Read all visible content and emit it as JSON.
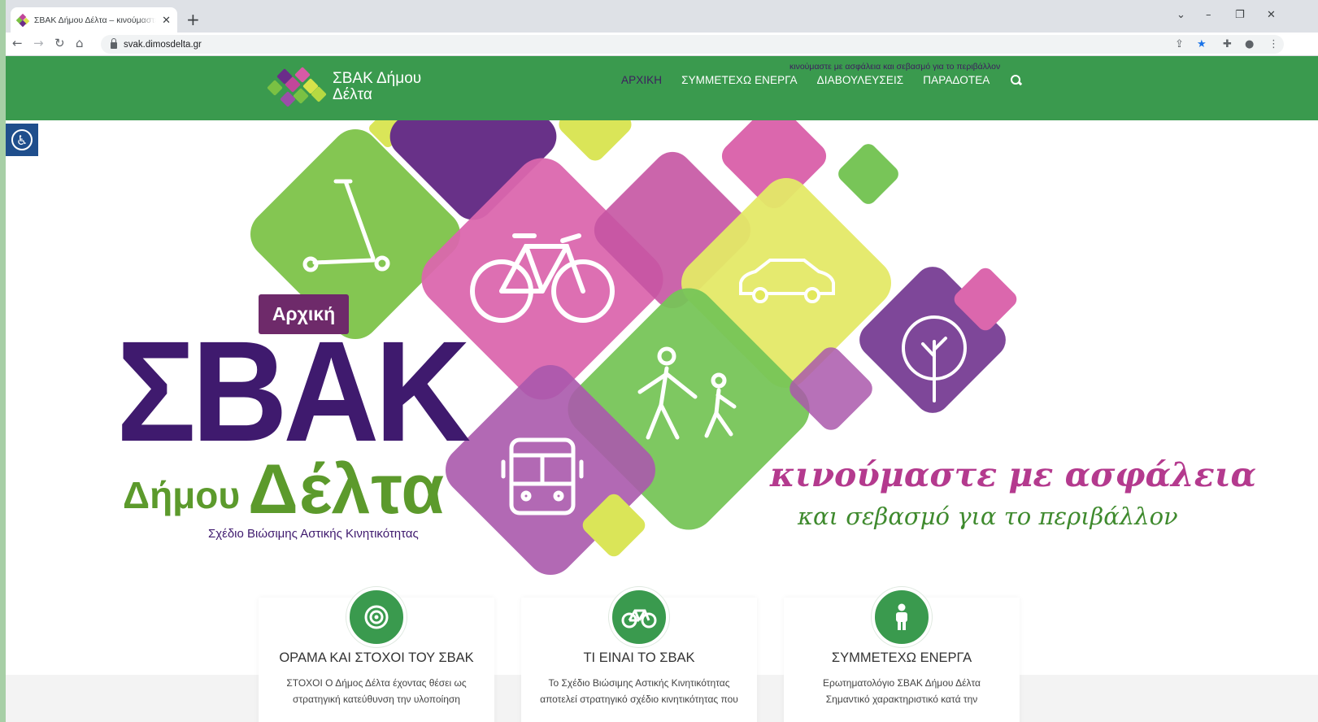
{
  "browser": {
    "tab_title": "ΣΒΑΚ Δήμου Δέλτα – κινούμαστε με ασφάλεια και σεβασμό για το περιβάλλον",
    "tab_close": "✕",
    "new_tab": "+",
    "url": "svak.dimosdelta.gr",
    "controls": {
      "tabsearch": "⌄",
      "minimize": "–",
      "restore": "❐",
      "close": "✕"
    },
    "nav": {
      "back": "←",
      "forward": "→",
      "reload": "↻",
      "home": "⌂"
    }
  },
  "site": {
    "name": "ΣΒΑΚ Δήμου Δέλτα",
    "tagline": "κινούμαστε με ασφάλεια και σεβασμό για το περιβάλλον",
    "nav": [
      {
        "label": "ΑΡΧΙΚΗ",
        "active": true
      },
      {
        "label": "ΣΥΜΜΕΤΕΧΩ ΕΝΕΡΓΑ",
        "active": false
      },
      {
        "label": "ΔΙΑΒΟΥΛΕΥΣΕΙΣ",
        "active": false
      },
      {
        "label": "ΠΑΡΑΔΟΤΕΑ",
        "active": false
      }
    ],
    "accent_green": "#3a9a4e",
    "accent_purple": "#3f1a6e"
  },
  "hero": {
    "badge": "Αρχική",
    "brand_big": "ΣΒΑΚ",
    "brand_sub1": "Δήμου",
    "brand_sub2": "Δέλτα",
    "brand_caption": "Σχέδιο Βιώσιμης Αστικής Κινητικότητας",
    "slogan_line1": "κινούμαστε με ασφάλεια",
    "slogan_line2": "και σεβασμό για το περιβάλλον",
    "icons": [
      "scooter-icon",
      "bicycle-icon",
      "car-icon",
      "pedestrians-icon",
      "tree-icon",
      "bus-icon"
    ]
  },
  "features": [
    {
      "icon": "target-icon",
      "title": "ΟΡΑΜΑ ΚΑΙ ΣΤΟΧΟΙ ΤΟΥ ΣΒΑΚ",
      "text_line1": "ΣΤΟΧΟΙ Ο Δήμος Δέλτα έχοντας θέσει ως",
      "text_line2": "στρατηγική κατεύθυνση την υλοποίηση"
    },
    {
      "icon": "bicycle-icon",
      "title": "ΤΙ ΕΙΝΑΙ ΤΟ ΣΒΑΚ",
      "text_line1": "Το Σχέδιο Βιώσιμης Αστικής Κινητικότητας",
      "text_line2": "αποτελεί στρατηγικό σχέδιο κινητικότητας που"
    },
    {
      "icon": "person-icon",
      "title": "ΣΥΜΜΕΤΕΧΩ ΕΝΕΡΓΑ",
      "text_line1": "Ερωτηματολόγιο ΣΒΑΚ Δήμου Δέλτα",
      "text_line2": "Σημαντικό χαρακτηριστικό κατά την"
    }
  ]
}
